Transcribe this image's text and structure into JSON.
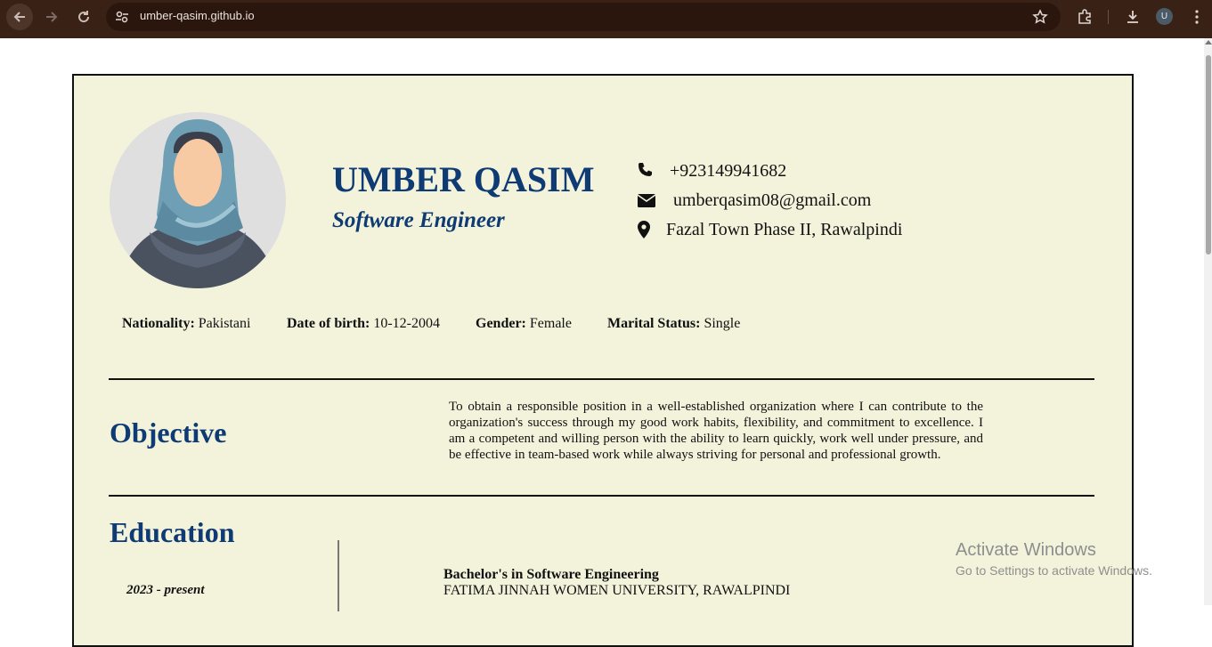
{
  "browser": {
    "url": "umber-qasim.github.io",
    "profile_initial": "U",
    "icons": [
      "back-arrow-icon",
      "forward-arrow-icon",
      "reload-icon",
      "site-settings-icon",
      "star-icon",
      "extensions-icon",
      "download-icon",
      "menu-dots-icon"
    ]
  },
  "resume": {
    "name": "UMBER QASIM",
    "title": "Software Engineer",
    "contact": {
      "phone": "+923149941682",
      "email": "umberqasim08@gmail.com",
      "address": "Fazal Town Phase II, Rawalpindi"
    },
    "personal": [
      {
        "label": "Nationality:",
        "value": "Pakistani"
      },
      {
        "label": "Date of birth:",
        "value": "10-12-2004"
      },
      {
        "label": "Gender:",
        "value": "Female"
      },
      {
        "label": "Marital Status:",
        "value": "Single"
      }
    ],
    "objective": {
      "heading": "Objective",
      "text": "To obtain a responsible position in a well-established organization where I can contribute to the organization's success through my good work habits, flexibility, and commitment to excellence. I am a competent and willing person with the ability to learn quickly, work well under pressure, and be effective in team-based work while always striving for personal and professional growth."
    },
    "education": {
      "heading": "Education",
      "entries": [
        {
          "date": "2023 - present",
          "degree": "Bachelor's in Software Engineering",
          "school": "FATIMA JINNAH WOMEN UNIVERSITY, RAWALPINDI"
        }
      ]
    }
  },
  "watermark": {
    "line1": "Activate Windows",
    "line2": "Go to Settings to activate Windows."
  },
  "colors": {
    "accent": "#0e3b73",
    "page_bg": "#f3f3dc",
    "chrome_bg": "#3a2116"
  }
}
